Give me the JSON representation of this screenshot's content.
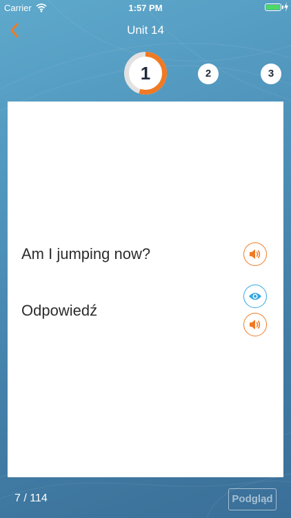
{
  "status_bar": {
    "carrier": "Carrier",
    "time": "1:57 PM"
  },
  "nav": {
    "title": "Unit 14",
    "back_icon": "chevron-left-icon"
  },
  "steps": [
    {
      "number": "1",
      "active": true,
      "progress": 0.55
    },
    {
      "number": "2",
      "active": false
    },
    {
      "number": "3",
      "active": false
    }
  ],
  "card": {
    "question": "Am I jumping now?",
    "answer": "Odpowiedź",
    "question_audio_icon": "speaker-icon",
    "reveal_icon": "eye-icon",
    "answer_audio_icon": "speaker-icon"
  },
  "footer": {
    "counter": "7 / 114",
    "preview_label": "Podgląd"
  },
  "colors": {
    "accent": "#f07a24",
    "eye": "#2fa6e0",
    "background": "#4f93bb",
    "battery": "#4cd964"
  }
}
